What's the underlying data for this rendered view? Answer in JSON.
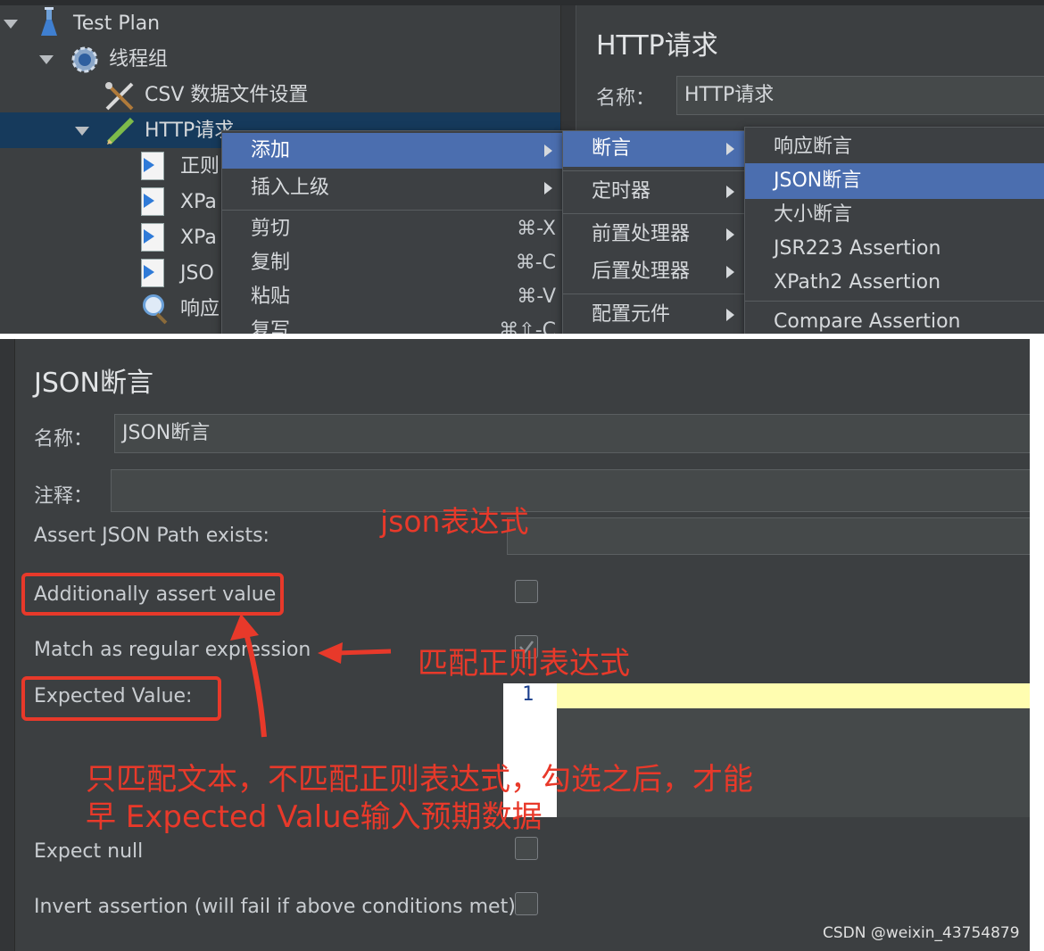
{
  "tree": {
    "test_plan": "Test Plan",
    "thread_group": "线程组",
    "csv_config": "CSV 数据文件设置",
    "http_request": "HTTP请求",
    "children": [
      "正则",
      "XPa",
      "XPa",
      "JSO",
      "响应"
    ]
  },
  "http_panel": {
    "title": "HTTP请求",
    "name_label": "名称：",
    "name_value": "HTTP请求"
  },
  "context_menu": {
    "items": [
      {
        "label": "添加",
        "shortcut": ""
      },
      {
        "label": "插入上级",
        "shortcut": ""
      },
      {
        "label": "剪切",
        "shortcut": "⌘-X"
      },
      {
        "label": "复制",
        "shortcut": "⌘-C"
      },
      {
        "label": "粘贴",
        "shortcut": "⌘-V"
      },
      {
        "label": "复写",
        "shortcut": "⌘⇧-C"
      }
    ]
  },
  "submenu_add": {
    "items": [
      "断言",
      "定时器",
      "前置处理器",
      "后置处理器",
      "配置元件"
    ]
  },
  "submenu_assertion": {
    "items": [
      "响应断言",
      "JSON断言",
      "大小断言",
      "JSR223 Assertion",
      "XPath2 Assertion",
      "Compare Assertion"
    ]
  },
  "json_assertion": {
    "title": "JSON断言",
    "name_label": "名称：",
    "name_value": "JSON断言",
    "comment_label": "注释：",
    "path_label": "Assert JSON Path exists:",
    "additionally_label": "Additionally assert value",
    "regex_label": "Match as regular expression",
    "expected_label": "Expected Value:",
    "line_number": "1",
    "expect_null_label": "Expect null",
    "invert_label": "Invert assertion (will fail if above conditions met)"
  },
  "annotations": {
    "json_expr": "json表达式",
    "match_regex": "匹配正则表达式",
    "note_line1": "只匹配文本，不匹配正则表达式，勾选之后，才能",
    "note_line2": "早 Expected Value输入预期数据"
  },
  "watermark": "CSDN @weixin_43754879",
  "colors": {
    "panel_bg": "#3c3f41",
    "menu_highlight": "#4b6eaf",
    "annotation_red": "#e8392a",
    "tree_selection": "#163a5c"
  }
}
